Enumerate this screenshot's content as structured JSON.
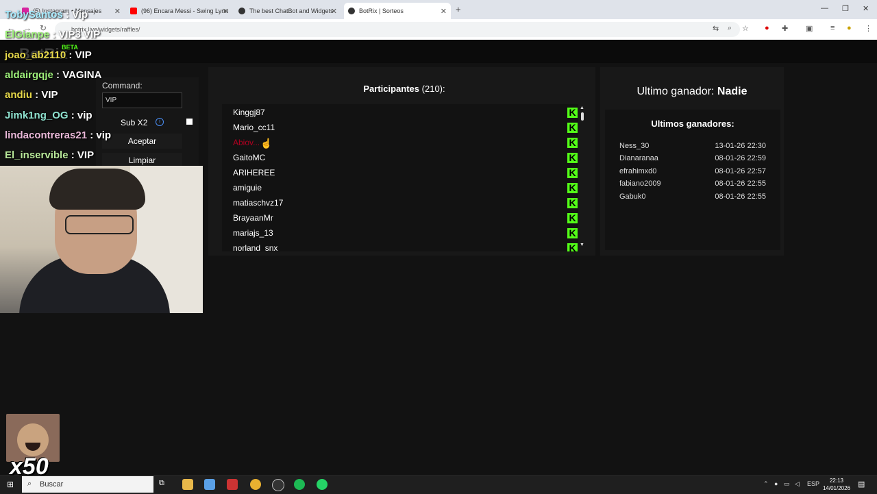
{
  "browser": {
    "tabs": [
      {
        "label": "(5) Instagram • Mensajes",
        "active": false
      },
      {
        "label": "(96) Encara Messi - Swing Lynn",
        "active": false
      },
      {
        "label": "The best ChatBot and Widgets",
        "active": false
      },
      {
        "label": "BotRix | Sorteos",
        "active": true
      }
    ],
    "new_tab_icon": "+",
    "url": "botrix.live/widgets/raffles/"
  },
  "site": {
    "logo": "BotRix",
    "badge": "BETA"
  },
  "raffle": {
    "command_label": "Command:",
    "command_value": "VIP",
    "subx2_label": "Sub X2",
    "info_icon": "i",
    "accept_label": "Aceptar",
    "clear_label": "Limpiar"
  },
  "participants": {
    "title": "Participantes",
    "count": "(210):",
    "kick_glyph": "K",
    "items": [
      {
        "name": "Kinggj87"
      },
      {
        "name": "Mario_cc11"
      },
      {
        "name": "Abiov..."
      },
      {
        "name": "GaitoMC"
      },
      {
        "name": "ARIHEREE"
      },
      {
        "name": "amiguie"
      },
      {
        "name": "matiaschvz17"
      },
      {
        "name": "BrayaanMr"
      },
      {
        "name": "mariajs_13"
      },
      {
        "name": "norland_snx"
      }
    ],
    "scroll_up": "▲",
    "scroll_down": "▼"
  },
  "winner": {
    "last_label": "Ultimo ganador:",
    "last_value": "Nadie",
    "recent_title": "Ultimos ganadores:",
    "recent": [
      {
        "name": "Ness_30",
        "date": "13-01-26 22:30"
      },
      {
        "name": "Dianaranaa",
        "date": "08-01-26 22:59"
      },
      {
        "name": "efrahimxd0",
        "date": "08-01-26 22:57"
      },
      {
        "name": "fabiano2009",
        "date": "08-01-26 22:55"
      },
      {
        "name": "Gabuk0",
        "date": "08-01-26 22:55"
      }
    ]
  },
  "chat": [
    {
      "user": "TobySantos",
      "msg": " : Vip"
    },
    {
      "user": "ElGianpe",
      "msg": " : VIP3 VIP"
    },
    {
      "user": "joao_ab2110",
      "msg": " : VIP"
    },
    {
      "user": "aldairgqje",
      "msg": " : VAGINA"
    },
    {
      "user": "andiu",
      "msg": " : VIP"
    },
    {
      "user": "Jimk1ng_OG",
      "msg": " : vip"
    },
    {
      "user": "lindacontreras21",
      "msg": " : vip"
    },
    {
      "user": "El_inservible",
      "msg": " : VIP"
    }
  ],
  "overlay": {
    "meme_count": "x50"
  },
  "taskbar": {
    "search_placeholder": "Buscar",
    "lang": "ESP",
    "time": "22:13",
    "date": "14/01/2026"
  },
  "colors": {
    "kick_green": "#53fc18",
    "panel": "#181818",
    "background": "#121212",
    "chat_user": "#9ef07a"
  }
}
